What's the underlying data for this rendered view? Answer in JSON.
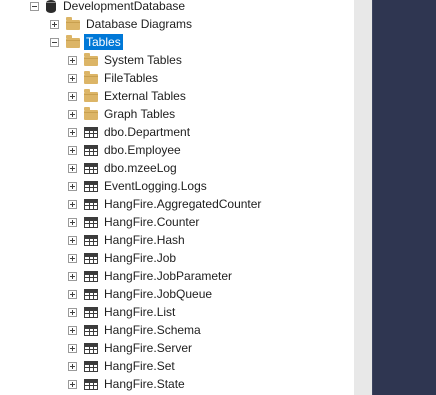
{
  "tree": {
    "database": {
      "label": "DevelopmentDatabase"
    },
    "database_diagrams": {
      "label": "Database Diagrams"
    },
    "tables": {
      "label": "Tables",
      "folders": [
        {
          "label": "System Tables"
        },
        {
          "label": "FileTables"
        },
        {
          "label": "External Tables"
        },
        {
          "label": "Graph Tables"
        }
      ],
      "items": [
        {
          "label": "dbo.Department"
        },
        {
          "label": "dbo.Employee"
        },
        {
          "label": "dbo.mzeeLog"
        },
        {
          "label": "EventLogging.Logs"
        },
        {
          "label": "HangFire.AggregatedCounter"
        },
        {
          "label": "HangFire.Counter"
        },
        {
          "label": "HangFire.Hash"
        },
        {
          "label": "HangFire.Job"
        },
        {
          "label": "HangFire.JobParameter"
        },
        {
          "label": "HangFire.JobQueue"
        },
        {
          "label": "HangFire.List"
        },
        {
          "label": "HangFire.Schema"
        },
        {
          "label": "HangFire.Server"
        },
        {
          "label": "HangFire.Set"
        },
        {
          "label": "HangFire.State"
        }
      ]
    }
  },
  "colors": {
    "selection": "#0078d7",
    "folder": "#dcb567",
    "side_panel": "#2f3651",
    "scrollbar_track": "#e8e8e8"
  },
  "icons": {
    "database": "database-icon",
    "folder": "folder-icon",
    "table": "table-icon",
    "expanded": "collapse-icon",
    "collapsed": "expand-icon"
  }
}
